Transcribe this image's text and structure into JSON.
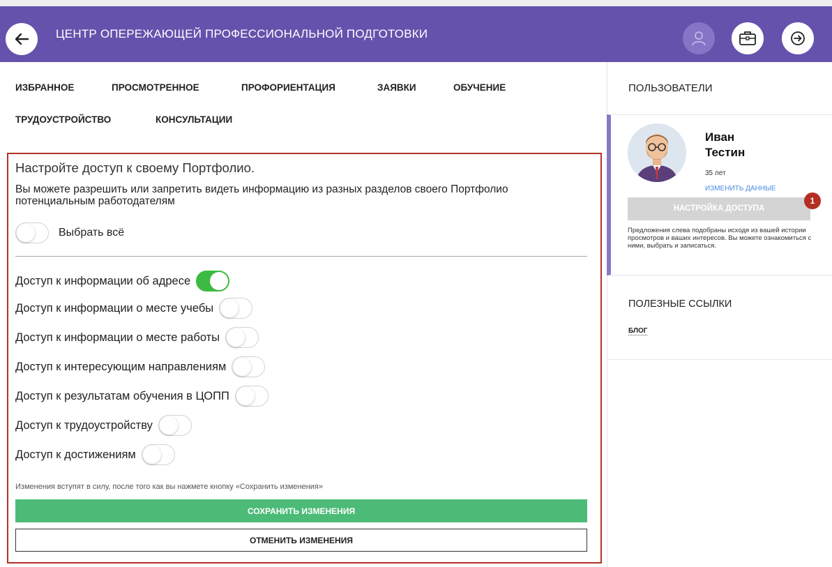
{
  "header": {
    "title": "ЦЕНТР ОПЕРЕЖАЮЩЕЙ ПРОФЕССИОНАЛЬНОЙ ПОДГОТОВКИ",
    "color": "#6452ac"
  },
  "tabs": [
    {
      "label": "ИЗБРАННОЕ"
    },
    {
      "label": "ПРОСМОТРЕННОЕ"
    },
    {
      "label": "ПРОФОРИЕНТАЦИЯ"
    },
    {
      "label": "ЗАЯВКИ"
    },
    {
      "label": "ОБУЧЕНИЕ"
    },
    {
      "label": "ТРУДОУСТРОЙСТВО"
    },
    {
      "label": "КОНСУЛЬТАЦИИ"
    }
  ],
  "panel": {
    "title": "Настройте доступ к своему Портфолио.",
    "description": "Вы можете разрешить или запретить видеть информацию из разных разделов своего Портфолио потенциальным работодателям",
    "select_all_label": "Выбрать всё",
    "select_all_on": false,
    "access_items": [
      {
        "label": "Доступ к информации об адресе",
        "on": true
      },
      {
        "label": "Доступ к информации о месте учебы",
        "on": false
      },
      {
        "label": "Доступ к информации о месте работы",
        "on": false
      },
      {
        "label": "Доступ к интересующим направлениям",
        "on": false
      },
      {
        "label": "Доступ к результатам обучения в ЦОПП",
        "on": false
      },
      {
        "label": "Доступ к трудоустройству",
        "on": false
      },
      {
        "label": "Доступ к достижениям",
        "on": false
      }
    ],
    "note": "Изменения вступят в силу, после того как вы нажмете кнопку «Сохранить изменения»",
    "save_label": "СОХРАНИТЬ ИЗМЕНЕНИЯ",
    "cancel_label": "ОТМЕНИТЬ ИЗМЕНЕНИЯ"
  },
  "sidebar": {
    "users_title": "ПОЛЬЗОВАТЕЛИ",
    "user": {
      "first_name": "Иван",
      "last_name": "Тестин",
      "age": "35 лет",
      "edit_link": "ИЗМЕНИТЬ ДАННЫЕ"
    },
    "access_button": "НАСТРОЙКА ДОСТУПА",
    "badge_count": "1",
    "note": "Предложения слева подобраны исходя из вашей истории просмотров и ваших интересов. Вы можете ознакомиться с ними, выбрать и записаться.",
    "links_title": "ПОЛЕЗНЫЕ ССЫЛКИ",
    "links": [
      {
        "label": "БЛОГ"
      }
    ]
  },
  "colors": {
    "accent": "#6452ac",
    "toggle_on": "#3cba42",
    "save": "#4dbb78",
    "panel_border": "#b53227",
    "badge": "#b42f22"
  }
}
